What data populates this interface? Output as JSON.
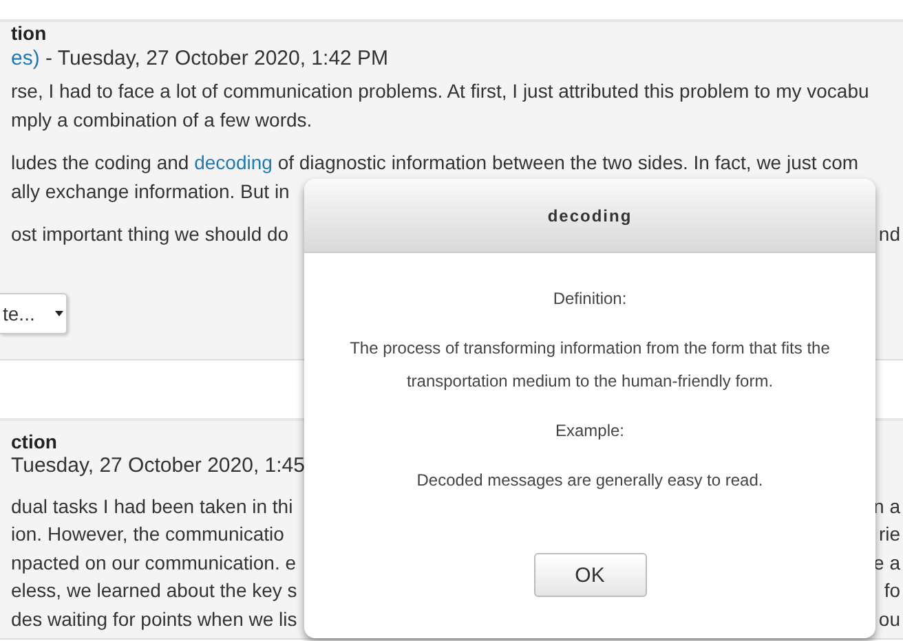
{
  "posts": [
    {
      "title": "tion",
      "lines": [
        {
          "parts": [
            {
              "kind": "link",
              "text": "es)"
            },
            {
              "kind": "text",
              "text": " - Tuesday, 27 October 2020, 1:42 PM"
            }
          ]
        },
        {
          "gap": true,
          "parts": [
            {
              "kind": "text",
              "text": "rse, I had to face a lot of communication problems. At first, I just attributed this problem to my vocabu"
            }
          ]
        },
        {
          "parts": [
            {
              "kind": "text",
              "text": "mply a combination of a few words."
            }
          ]
        },
        {
          "gap": true,
          "parts": [
            {
              "kind": "text",
              "text": "ludes the coding and "
            },
            {
              "kind": "link",
              "text": "decoding"
            },
            {
              "kind": "text",
              "text": " of diagnostic information between the two sides. In fact, we just com"
            }
          ]
        },
        {
          "parts": [
            {
              "kind": "text",
              "text": "ally exchange information. But in"
            }
          ]
        },
        {
          "gap": true,
          "parts": [
            {
              "kind": "text",
              "text": "ost important thing we should do"
            }
          ],
          "right": "nd"
        }
      ],
      "select": "te..."
    },
    {
      "title": "ction",
      "lines": [
        {
          "parts": [
            {
              "kind": "text",
              "text": "Tuesday, 27 October 2020, 1:45"
            }
          ]
        },
        {
          "gap": true,
          "parts": [
            {
              "kind": "text",
              "text": "dual tasks I had been taken in thi"
            }
          ],
          "right": "n a"
        },
        {
          "parts": [
            {
              "kind": "text",
              "text": "ion. However, the communicatio"
            }
          ],
          "right": "rie"
        },
        {
          "parts": [
            {
              "kind": "text",
              "text": "npacted on our communication. e"
            }
          ],
          "right": "e a"
        },
        {
          "parts": [
            {
              "kind": "text",
              "text": "eless, we learned about the key s"
            }
          ],
          "right": "fo"
        },
        {
          "parts": [
            {
              "kind": "text",
              "text": "des waiting for points when we lis"
            }
          ],
          "right": "ou"
        }
      ]
    }
  ],
  "dialog": {
    "title": "decoding",
    "body": [
      "Definition:",
      "The process of transforming information from the form that fits the transportation medium to the human-friendly form.",
      "Example:",
      "Decoded messages are generally easy to read."
    ],
    "button": "OK"
  }
}
